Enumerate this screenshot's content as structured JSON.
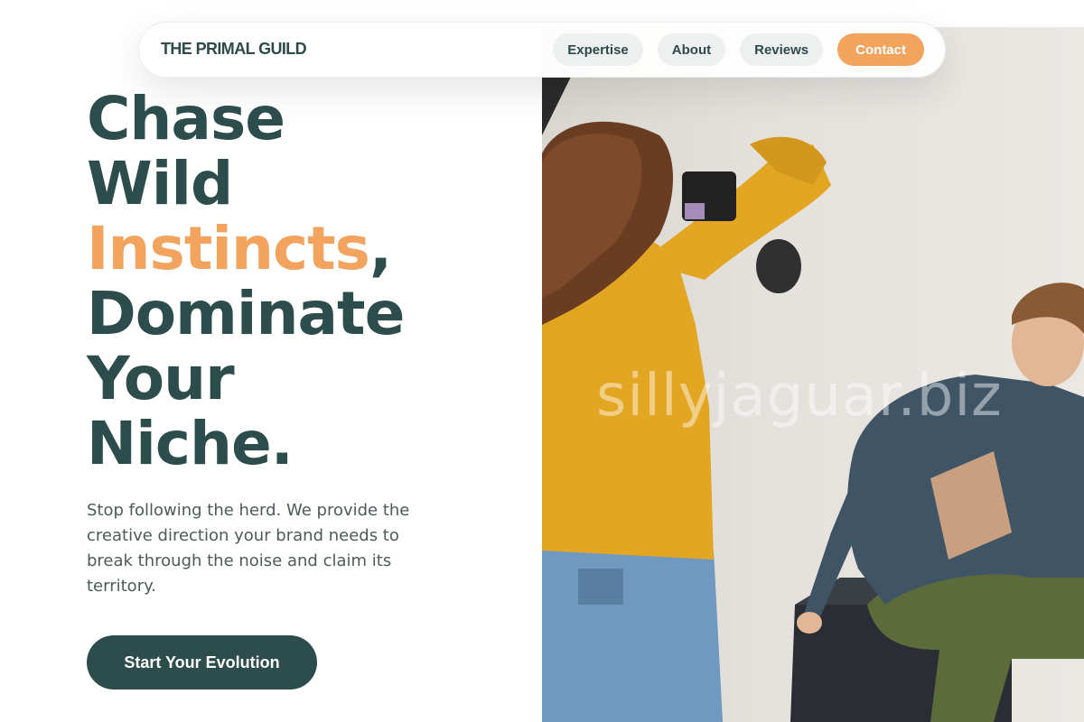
{
  "nav": {
    "brand": "THE PRIMAL GUILD",
    "links": [
      "Expertise",
      "About",
      "Reviews"
    ],
    "contact_label": "Contact"
  },
  "hero": {
    "line1": "Chase",
    "line2": "Wild",
    "line3_accent": "Instincts",
    "line3_suffix": ",",
    "line4": "Dominate",
    "line5": "Your",
    "line6": "Niche.",
    "subtext": "Stop following the herd. We provide the creative direction your brand needs to break through the noise and claim its territory.",
    "cta_label": "Start Your Evolution"
  },
  "photo": {
    "watermark": "sillyjaguar.biz"
  },
  "colors": {
    "primary": "#2d4c4c",
    "accent": "#f2a35d",
    "pill_bg": "#eef0ef",
    "body_text": "#4d5a5a"
  }
}
